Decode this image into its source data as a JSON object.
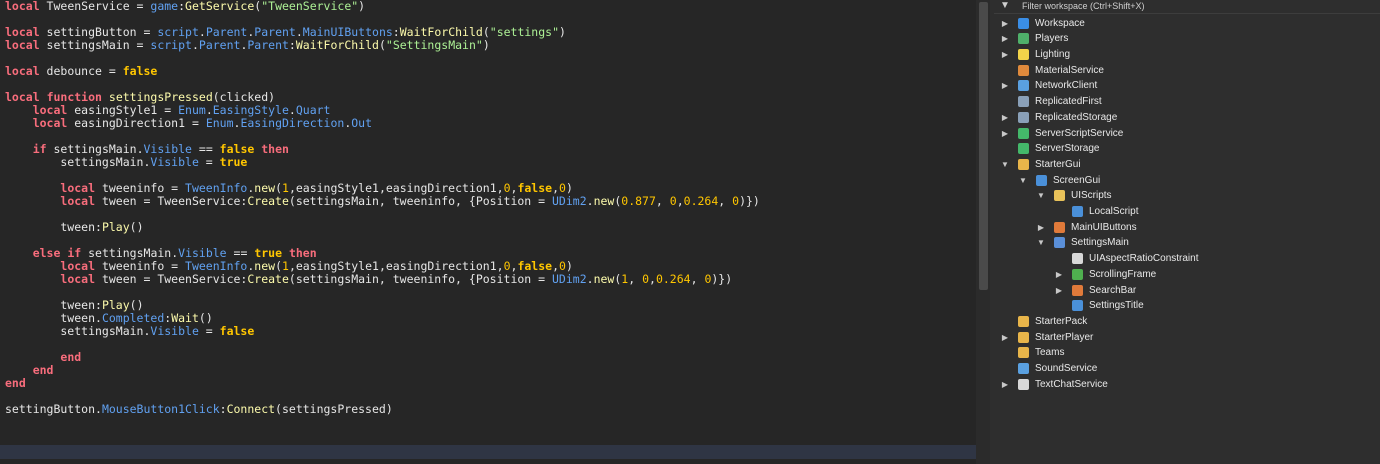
{
  "editor": {
    "lines": [
      [
        {
          "t": "local",
          "c": "kw"
        },
        {
          "t": " TweenService = "
        },
        {
          "t": "game",
          "c": "prop"
        },
        {
          "t": ":"
        },
        {
          "t": "GetService",
          "c": "fn"
        },
        {
          "t": "("
        },
        {
          "t": "\"TweenService\"",
          "c": "str"
        },
        {
          "t": ")"
        }
      ],
      [],
      [
        {
          "t": "local",
          "c": "kw"
        },
        {
          "t": " settingButton = "
        },
        {
          "t": "script",
          "c": "prop"
        },
        {
          "t": "."
        },
        {
          "t": "Parent",
          "c": "prop"
        },
        {
          "t": "."
        },
        {
          "t": "Parent",
          "c": "prop"
        },
        {
          "t": "."
        },
        {
          "t": "MainUIButtons",
          "c": "prop"
        },
        {
          "t": ":"
        },
        {
          "t": "WaitForChild",
          "c": "fn"
        },
        {
          "t": "("
        },
        {
          "t": "\"settings\"",
          "c": "str"
        },
        {
          "t": ")"
        }
      ],
      [
        {
          "t": "local",
          "c": "kw"
        },
        {
          "t": " settingsMain = "
        },
        {
          "t": "script",
          "c": "prop"
        },
        {
          "t": "."
        },
        {
          "t": "Parent",
          "c": "prop"
        },
        {
          "t": "."
        },
        {
          "t": "Parent",
          "c": "prop"
        },
        {
          "t": ":"
        },
        {
          "t": "WaitForChild",
          "c": "fn"
        },
        {
          "t": "("
        },
        {
          "t": "\"SettingsMain\"",
          "c": "str"
        },
        {
          "t": ")"
        }
      ],
      [],
      [
        {
          "t": "local",
          "c": "kw"
        },
        {
          "t": " debounce = "
        },
        {
          "t": "false",
          "c": "bool"
        }
      ],
      [],
      [
        {
          "t": "local",
          "c": "kw"
        },
        {
          "t": " "
        },
        {
          "t": "function",
          "c": "kw"
        },
        {
          "t": " "
        },
        {
          "t": "settingsPressed",
          "c": "fn"
        },
        {
          "t": "(clicked)"
        }
      ],
      [
        {
          "t": "    "
        },
        {
          "t": "local",
          "c": "kw"
        },
        {
          "t": " easingStyle1 = "
        },
        {
          "t": "Enum",
          "c": "prop"
        },
        {
          "t": "."
        },
        {
          "t": "EasingStyle",
          "c": "prop"
        },
        {
          "t": "."
        },
        {
          "t": "Quart",
          "c": "prop"
        }
      ],
      [
        {
          "t": "    "
        },
        {
          "t": "local",
          "c": "kw"
        },
        {
          "t": " easingDirection1 = "
        },
        {
          "t": "Enum",
          "c": "prop"
        },
        {
          "t": "."
        },
        {
          "t": "EasingDirection",
          "c": "prop"
        },
        {
          "t": "."
        },
        {
          "t": "Out",
          "c": "prop"
        }
      ],
      [],
      [
        {
          "t": "    "
        },
        {
          "t": "if",
          "c": "kw"
        },
        {
          "t": " settingsMain."
        },
        {
          "t": "Visible",
          "c": "prop"
        },
        {
          "t": " == "
        },
        {
          "t": "false",
          "c": "bool"
        },
        {
          "t": " "
        },
        {
          "t": "then",
          "c": "kw"
        }
      ],
      [
        {
          "t": "        settingsMain."
        },
        {
          "t": "Visible",
          "c": "prop"
        },
        {
          "t": " = "
        },
        {
          "t": "true",
          "c": "bool"
        }
      ],
      [],
      [
        {
          "t": "        "
        },
        {
          "t": "local",
          "c": "kw"
        },
        {
          "t": " tweeninfo = "
        },
        {
          "t": "TweenInfo",
          "c": "prop"
        },
        {
          "t": "."
        },
        {
          "t": "new",
          "c": "fn"
        },
        {
          "t": "("
        },
        {
          "t": "1",
          "c": "num"
        },
        {
          "t": ",easingStyle1,easingDirection1,"
        },
        {
          "t": "0",
          "c": "num"
        },
        {
          "t": ","
        },
        {
          "t": "false",
          "c": "bool"
        },
        {
          "t": ","
        },
        {
          "t": "0",
          "c": "num"
        },
        {
          "t": ")"
        }
      ],
      [
        {
          "t": "        "
        },
        {
          "t": "local",
          "c": "kw"
        },
        {
          "t": " tween = TweenService:"
        },
        {
          "t": "Create",
          "c": "fn"
        },
        {
          "t": "(settingsMain, tweeninfo, {Position = "
        },
        {
          "t": "UDim2",
          "c": "prop"
        },
        {
          "t": "."
        },
        {
          "t": "new",
          "c": "fn"
        },
        {
          "t": "("
        },
        {
          "t": "0.877",
          "c": "num"
        },
        {
          "t": ", "
        },
        {
          "t": "0",
          "c": "num"
        },
        {
          "t": ","
        },
        {
          "t": "0.264",
          "c": "num"
        },
        {
          "t": ", "
        },
        {
          "t": "0",
          "c": "num"
        },
        {
          "t": ")})"
        }
      ],
      [],
      [
        {
          "t": "        tween:"
        },
        {
          "t": "Play",
          "c": "fn"
        },
        {
          "t": "()"
        }
      ],
      [],
      [
        {
          "t": "    "
        },
        {
          "t": "else",
          "c": "kw"
        },
        {
          "t": " "
        },
        {
          "t": "if",
          "c": "kw"
        },
        {
          "t": " settingsMain."
        },
        {
          "t": "Visible",
          "c": "prop"
        },
        {
          "t": " == "
        },
        {
          "t": "true",
          "c": "bool"
        },
        {
          "t": " "
        },
        {
          "t": "then",
          "c": "kw"
        }
      ],
      [
        {
          "t": "        "
        },
        {
          "t": "local",
          "c": "kw"
        },
        {
          "t": " tweeninfo = "
        },
        {
          "t": "TweenInfo",
          "c": "prop"
        },
        {
          "t": "."
        },
        {
          "t": "new",
          "c": "fn"
        },
        {
          "t": "("
        },
        {
          "t": "1",
          "c": "num"
        },
        {
          "t": ",easingStyle1,easingDirection1,"
        },
        {
          "t": "0",
          "c": "num"
        },
        {
          "t": ","
        },
        {
          "t": "false",
          "c": "bool"
        },
        {
          "t": ","
        },
        {
          "t": "0",
          "c": "num"
        },
        {
          "t": ")"
        }
      ],
      [
        {
          "t": "        "
        },
        {
          "t": "local",
          "c": "kw"
        },
        {
          "t": " tween = TweenService:"
        },
        {
          "t": "Create",
          "c": "fn"
        },
        {
          "t": "(settingsMain, tweeninfo, {Position = "
        },
        {
          "t": "UDim2",
          "c": "prop"
        },
        {
          "t": "."
        },
        {
          "t": "new",
          "c": "fn"
        },
        {
          "t": "("
        },
        {
          "t": "1",
          "c": "num"
        },
        {
          "t": ", "
        },
        {
          "t": "0",
          "c": "num"
        },
        {
          "t": ","
        },
        {
          "t": "0.264",
          "c": "num"
        },
        {
          "t": ", "
        },
        {
          "t": "0",
          "c": "num"
        },
        {
          "t": ")})"
        }
      ],
      [],
      [
        {
          "t": "        tween:"
        },
        {
          "t": "Play",
          "c": "fn"
        },
        {
          "t": "()"
        }
      ],
      [
        {
          "t": "        tween."
        },
        {
          "t": "Completed",
          "c": "prop"
        },
        {
          "t": ":"
        },
        {
          "t": "Wait",
          "c": "fn"
        },
        {
          "t": "()"
        }
      ],
      [
        {
          "t": "        settingsMain."
        },
        {
          "t": "Visible",
          "c": "prop"
        },
        {
          "t": " = "
        },
        {
          "t": "false",
          "c": "bool"
        }
      ],
      [],
      [
        {
          "t": "        "
        },
        {
          "t": "end",
          "c": "kw"
        }
      ],
      [
        {
          "t": "    "
        },
        {
          "t": "end",
          "c": "kw"
        }
      ],
      [
        {
          "t": "end",
          "c": "kw"
        }
      ],
      [],
      [
        {
          "t": "settingButton."
        },
        {
          "t": "MouseButton1Click",
          "c": "prop"
        },
        {
          "t": ":"
        },
        {
          "t": "Connect",
          "c": "fn"
        },
        {
          "t": "(settingsPressed)"
        }
      ]
    ]
  },
  "explorer": {
    "filter_placeholder": "Filter workspace (Ctrl+Shift+X)",
    "filter_icon": "filter-icon",
    "items": [
      {
        "label": "Workspace",
        "depth": 0,
        "arrow": "collapsed",
        "icon": "workspace-icon",
        "color": "#3a8ee6"
      },
      {
        "label": "Players",
        "depth": 0,
        "arrow": "collapsed",
        "icon": "players-icon",
        "color": "#4fb06a"
      },
      {
        "label": "Lighting",
        "depth": 0,
        "arrow": "collapsed",
        "icon": "lighting-icon",
        "color": "#f2d44a"
      },
      {
        "label": "MaterialService",
        "depth": 0,
        "arrow": "none",
        "icon": "material-service-icon",
        "color": "#e08a3c"
      },
      {
        "label": "NetworkClient",
        "depth": 0,
        "arrow": "collapsed",
        "icon": "network-client-icon",
        "color": "#5aa0e0"
      },
      {
        "label": "ReplicatedFirst",
        "depth": 0,
        "arrow": "none",
        "icon": "replicated-first-icon",
        "color": "#8aa0b8"
      },
      {
        "label": "ReplicatedStorage",
        "depth": 0,
        "arrow": "collapsed",
        "icon": "replicated-storage-icon",
        "color": "#8aa0b8"
      },
      {
        "label": "ServerScriptService",
        "depth": 0,
        "arrow": "collapsed",
        "icon": "server-script-service-icon",
        "color": "#44b86a"
      },
      {
        "label": "ServerStorage",
        "depth": 0,
        "arrow": "none",
        "icon": "server-storage-icon",
        "color": "#44b86a"
      },
      {
        "label": "StarterGui",
        "depth": 0,
        "arrow": "expanded",
        "icon": "starter-gui-icon",
        "color": "#e8b54a"
      },
      {
        "label": "ScreenGui",
        "depth": 1,
        "arrow": "expanded",
        "icon": "screen-gui-icon",
        "color": "#4a90d9"
      },
      {
        "label": "UIScripts",
        "depth": 2,
        "arrow": "expanded",
        "icon": "folder-icon",
        "color": "#e8c25a"
      },
      {
        "label": "LocalScript",
        "depth": 3,
        "arrow": "none",
        "icon": "local-script-icon",
        "color": "#4a90d9"
      },
      {
        "label": "MainUIButtons",
        "depth": 2,
        "arrow": "collapsed",
        "icon": "frame-icon",
        "color": "#e07a3a"
      },
      {
        "label": "SettingsMain",
        "depth": 2,
        "arrow": "expanded",
        "icon": "image-label-icon",
        "color": "#5a8fd8"
      },
      {
        "label": "UIAspectRatioConstraint",
        "depth": 3,
        "arrow": "none",
        "icon": "aspect-ratio-icon",
        "color": "#d8d8d8"
      },
      {
        "label": "ScrollingFrame",
        "depth": 3,
        "arrow": "collapsed",
        "icon": "scrolling-frame-icon",
        "color": "#4fb04f"
      },
      {
        "label": "SearchBar",
        "depth": 3,
        "arrow": "collapsed",
        "icon": "frame-icon",
        "color": "#e07a3a"
      },
      {
        "label": "SettingsTitle",
        "depth": 3,
        "arrow": "none",
        "icon": "text-label-icon",
        "color": "#4a90d9"
      },
      {
        "label": "StarterPack",
        "depth": 0,
        "arrow": "none",
        "icon": "starter-pack-icon",
        "color": "#e8b54a"
      },
      {
        "label": "StarterPlayer",
        "depth": 0,
        "arrow": "collapsed",
        "icon": "starter-player-icon",
        "color": "#e8b54a"
      },
      {
        "label": "Teams",
        "depth": 0,
        "arrow": "none",
        "icon": "teams-icon",
        "color": "#e8b54a"
      },
      {
        "label": "SoundService",
        "depth": 0,
        "arrow": "none",
        "icon": "sound-service-icon",
        "color": "#5aa0e0"
      },
      {
        "label": "TextChatService",
        "depth": 0,
        "arrow": "collapsed",
        "icon": "text-chat-service-icon",
        "color": "#d8d8d8"
      }
    ]
  }
}
